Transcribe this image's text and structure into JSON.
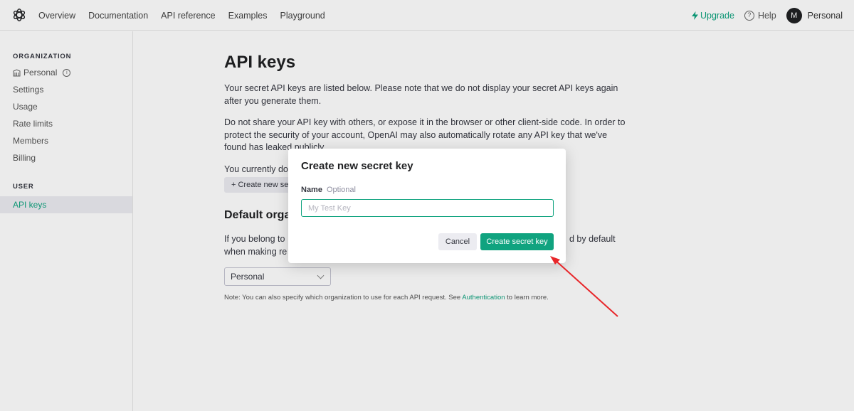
{
  "nav": {
    "links": [
      "Overview",
      "Documentation",
      "API reference",
      "Examples",
      "Playground"
    ],
    "upgrade": "Upgrade",
    "help": "Help",
    "avatar_initial": "M",
    "account": "Personal"
  },
  "sidebar": {
    "org_title": "ORGANIZATION",
    "org_items": [
      "Personal",
      "Settings",
      "Usage",
      "Rate limits",
      "Members",
      "Billing"
    ],
    "user_title": "USER",
    "user_items": [
      "API keys"
    ]
  },
  "main": {
    "title": "API keys",
    "para1": "Your secret API keys are listed below. Please note that we do not display your secret API keys again after you generate them.",
    "para2": "Do not share your API key with others, or expose it in the browser or other client-side code. In order to protect the security of your account, OpenAI may also automatically rotate any API key that we've found has leaked publicly.",
    "para3_visible": "You currently do",
    "create_btn_visible": "+ Create new se",
    "section_title_visible": "Default organ",
    "para4_left": "If you belong to",
    "para4_left_line2": "when making re",
    "para4_right": "d by default",
    "select_value": "Personal",
    "note_prefix": "Note: You can also specify which organization to use for each API request. See ",
    "note_link": "Authentication",
    "note_suffix": " to learn more."
  },
  "modal": {
    "title": "Create new secret key",
    "name_label": "Name",
    "optional_label": "Optional",
    "input_placeholder": "My Test Key",
    "cancel": "Cancel",
    "create": "Create secret key"
  },
  "colors": {
    "accent": "#10a37f",
    "annotation_arrow": "#e8262a"
  }
}
